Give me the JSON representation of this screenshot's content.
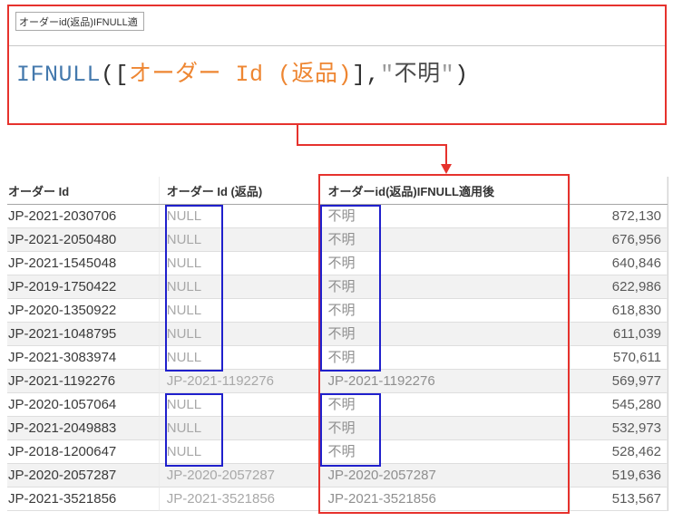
{
  "formula_editor": {
    "title_value": "オーダーid(返品)IFNULL適",
    "formula_string": "IFNULL([オーダー Id (返品)],\"不明\")",
    "formula_tokens": [
      {
        "type": "function",
        "text": "IFNULL"
      },
      {
        "type": "plain",
        "text": "(["
      },
      {
        "type": "field",
        "text": "オーダー Id (返品)"
      },
      {
        "type": "plain",
        "text": "],"
      },
      {
        "type": "quote",
        "text": "\""
      },
      {
        "type": "string",
        "text": "不明"
      },
      {
        "type": "quote",
        "text": "\""
      },
      {
        "type": "plain",
        "text": ")"
      }
    ]
  },
  "table": {
    "headers": [
      "オーダー Id",
      "オーダー Id (返品)",
      "オーダーid(返品)IFNULL適用後",
      ""
    ],
    "null_literal": "NULL",
    "replacement_value": "不明",
    "rows": [
      [
        "JP-2021-2030706",
        "NULL",
        "不明",
        "872,130"
      ],
      [
        "JP-2021-2050480",
        "NULL",
        "不明",
        "676,956"
      ],
      [
        "JP-2021-1545048",
        "NULL",
        "不明",
        "640,846"
      ],
      [
        "JP-2019-1750422",
        "NULL",
        "不明",
        "622,986"
      ],
      [
        "JP-2020-1350922",
        "NULL",
        "不明",
        "618,830"
      ],
      [
        "JP-2021-1048795",
        "NULL",
        "不明",
        "611,039"
      ],
      [
        "JP-2021-3083974",
        "NULL",
        "不明",
        "570,611"
      ],
      [
        "JP-2021-1192276",
        "JP-2021-1192276",
        "JP-2021-1192276",
        "569,977"
      ],
      [
        "JP-2020-1057064",
        "NULL",
        "不明",
        "545,280"
      ],
      [
        "JP-2021-2049883",
        "NULL",
        "不明",
        "532,973"
      ],
      [
        "JP-2018-1200647",
        "NULL",
        "不明",
        "528,462"
      ],
      [
        "JP-2020-2057287",
        "JP-2020-2057287",
        "JP-2020-2057287",
        "519,636"
      ],
      [
        "JP-2021-3521856",
        "JP-2021-3521856",
        "JP-2021-3521856",
        "513,567"
      ]
    ]
  },
  "colors": {
    "annotation_red": "#e6322d",
    "annotation_blue": "#2020cc",
    "function_blue": "#4479ad",
    "field_orange": "#ee8632"
  }
}
